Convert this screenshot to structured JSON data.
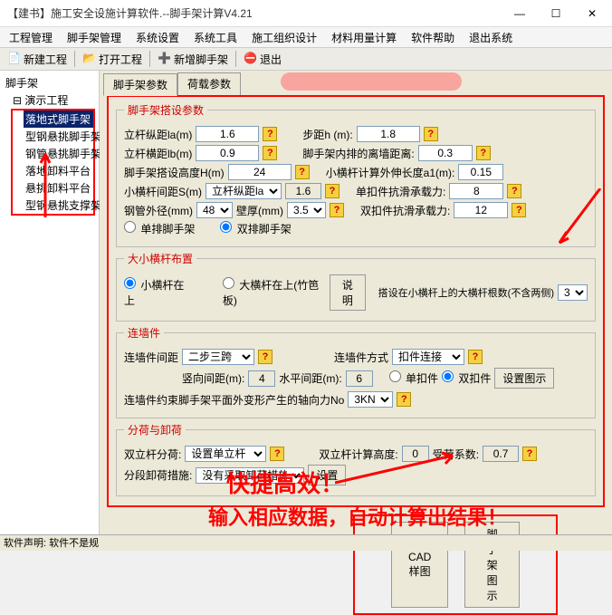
{
  "title": "【建书】施工安全设施计算软件.--脚手架计算V4.21",
  "menus": [
    "工程管理",
    "脚手架管理",
    "系统设置",
    "系统工具",
    "施工组织设计",
    "材料用量计算",
    "软件帮助",
    "退出系统"
  ],
  "tools": {
    "new": "新建工程",
    "open": "打开工程",
    "add": "新增脚手架",
    "exit": "退出"
  },
  "tree": {
    "root": "脚手架",
    "proj": "演示工程",
    "items": [
      "落地式脚手架",
      "型钢悬挑脚手架",
      "钢管悬挑脚手架",
      "落地卸料平台",
      "悬挑卸料平台",
      "型钢悬挑支撑架"
    ]
  },
  "tabs": [
    "脚手架参数",
    "荷载参数"
  ],
  "fs1": {
    "legend": "脚手架搭设参数",
    "la_lbl": "立杆纵距la(m)",
    "la": "1.6",
    "h_lbl": "步距h (m):",
    "h": "1.8",
    "lb_lbl": "立杆横距lb(m)",
    "lb": "0.9",
    "wall_lbl": "脚手架内排的离墙距离:",
    "wall": "0.3",
    "H_lbl": "脚手架搭设高度H(m)",
    "H": "24",
    "a1_lbl": "小横杆计算外伸长度a1(m):",
    "a1": "0.15",
    "s_lbl": "小横杆间距S(m)",
    "s_sel": "立杆纵距la",
    "s": "1.6",
    "dan_lbl": "单扣件抗滑承载力:",
    "dan": "8",
    "od_lbl": "钢管外径(mm)",
    "od": "48",
    "th_lbl": "壁厚(mm)",
    "th": "3.5",
    "shuang_lbl": "双扣件抗滑承载力:",
    "shuang": "12",
    "r1": "单排脚手架",
    "r2": "双排脚手架"
  },
  "fs2": {
    "legend": "大小横杆布置",
    "r1": "小横杆在上",
    "r2": "大横杆在上(竹笆板)",
    "btn": "说明",
    "note": "搭设在小横杆上的大横杆根数(不含两侧)",
    "val": "3"
  },
  "fs3": {
    "legend": "连墙件",
    "jj_lbl": "连墙件间距",
    "jj_sel": "二步三跨",
    "fs_lbl": "连墙件方式",
    "fs_sel": "扣件连接",
    "sx_lbl": "竖向间距(m):",
    "sx": "4",
    "sp_lbl": "水平间距(m):",
    "sp": "6",
    "r1": "单扣件",
    "r2": "双扣件",
    "btn": "设置图示",
    "no_lbl": "连墙件约束脚手架平面外变形产生的轴向力No",
    "no": "3KN"
  },
  "fs4": {
    "legend": "分荷与卸荷",
    "fl_lbl": "双立杆分荷:",
    "fl_sel": "设置单立杆",
    "gd_lbl": "双立杆计算高度:",
    "gd": "0",
    "xs_lbl": "受荷系数:",
    "xs": "0.7",
    "xh_lbl": "分段卸荷措施:",
    "xh_sel": "没有采取卸荷措施",
    "btn": "设置"
  },
  "bottom": {
    "cad": "CAD样图",
    "tu": "脚手架图示"
  },
  "anno1": "快捷高效！",
  "anno2": "输入相应数据，自动计算出结果！",
  "status": "软件声明: 软件不是规"
}
